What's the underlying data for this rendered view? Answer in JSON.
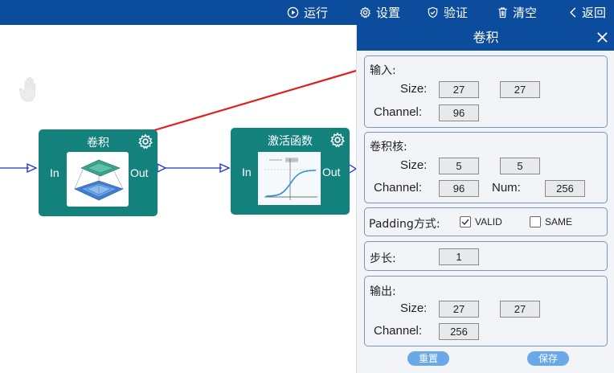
{
  "toolbar": {
    "run_label": "运行",
    "settings_label": "设置",
    "verify_label": "验证",
    "clear_label": "清空",
    "back_label": "返回"
  },
  "canvas": {
    "nodes": [
      {
        "title": "卷积",
        "in_label": "In",
        "out_label": "Out"
      },
      {
        "title": "激活函数",
        "in_label": "In",
        "out_label": "Out"
      }
    ]
  },
  "panel": {
    "title": "卷积",
    "input": {
      "header": "输入:",
      "size_label": "Size:",
      "size_w": "27",
      "size_h": "27",
      "channel_label": "Channel:",
      "channel": "96"
    },
    "kernel": {
      "header": "卷积核:",
      "size_label": "Size:",
      "size_w": "5",
      "size_h": "5",
      "channel_label": "Channel:",
      "channel": "96",
      "num_label": "Num:",
      "num": "256"
    },
    "padding": {
      "label": "Padding方式:",
      "valid_label": "VALID",
      "same_label": "SAME",
      "valid_checked": true,
      "same_checked": false
    },
    "stride": {
      "label": "步长:",
      "value": "1"
    },
    "output": {
      "header": "输出:",
      "size_label": "Size:",
      "size_w": "27",
      "size_h": "27",
      "channel_label": "Channel:",
      "channel": "256"
    },
    "reset_label": "重置",
    "save_label": "保存"
  },
  "colors": {
    "toolbar": "#0c4c9c",
    "node": "#13827d",
    "wire": "#1f2fd0",
    "arrow": "#e02020",
    "button": "#6aa8e8"
  }
}
